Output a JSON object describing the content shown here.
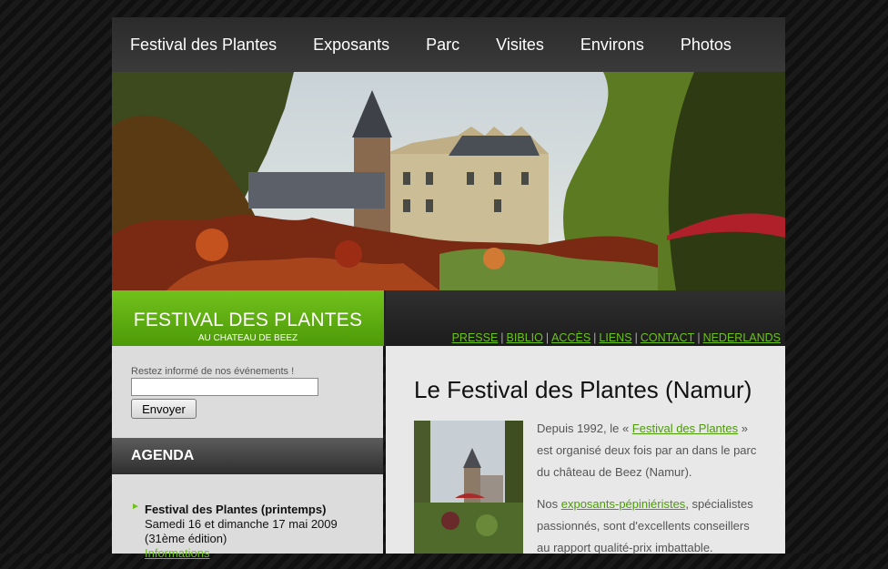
{
  "nav": {
    "items": [
      "Festival des Plantes",
      "Exposants",
      "Parc",
      "Visites",
      "Environs",
      "Photos"
    ]
  },
  "logo": {
    "title": "FESTIVAL DES PLANTES",
    "subtitle": "AU CHATEAU DE BEEZ"
  },
  "links": [
    "PRESSE",
    "BIBLIO",
    "ACCÈS",
    "LIENS",
    "CONTACT",
    "NEDERLANDS"
  ],
  "links_separator": "|",
  "newsletter": {
    "label": "Restez informé de nos événements !",
    "input_value": "",
    "button": "Envoyer"
  },
  "agenda": {
    "heading": "AGENDA",
    "item": {
      "title": "Festival des Plantes (printemps)",
      "date": "Samedi 16 et dimanche 17 mai 2009",
      "edition": "(31ème édition)",
      "link": "Informations"
    }
  },
  "main": {
    "heading": "Le Festival des Plantes (Namur)",
    "p1_before": "Depuis 1992, le « ",
    "p1_link": "Festival des Plantes",
    "p1_after": " » est organisé deux fois par an dans le parc du château de Beez (Namur).",
    "p2_before": "Nos ",
    "p2_link": "exposants-pépiniéristes",
    "p2_after": ", spécialistes passionnés, sont d'excellents conseillers au rapport qualité-prix imbattable."
  },
  "colors": {
    "accent": "#6cc217",
    "logo_green": "#5aaa10",
    "background": "#151515"
  }
}
